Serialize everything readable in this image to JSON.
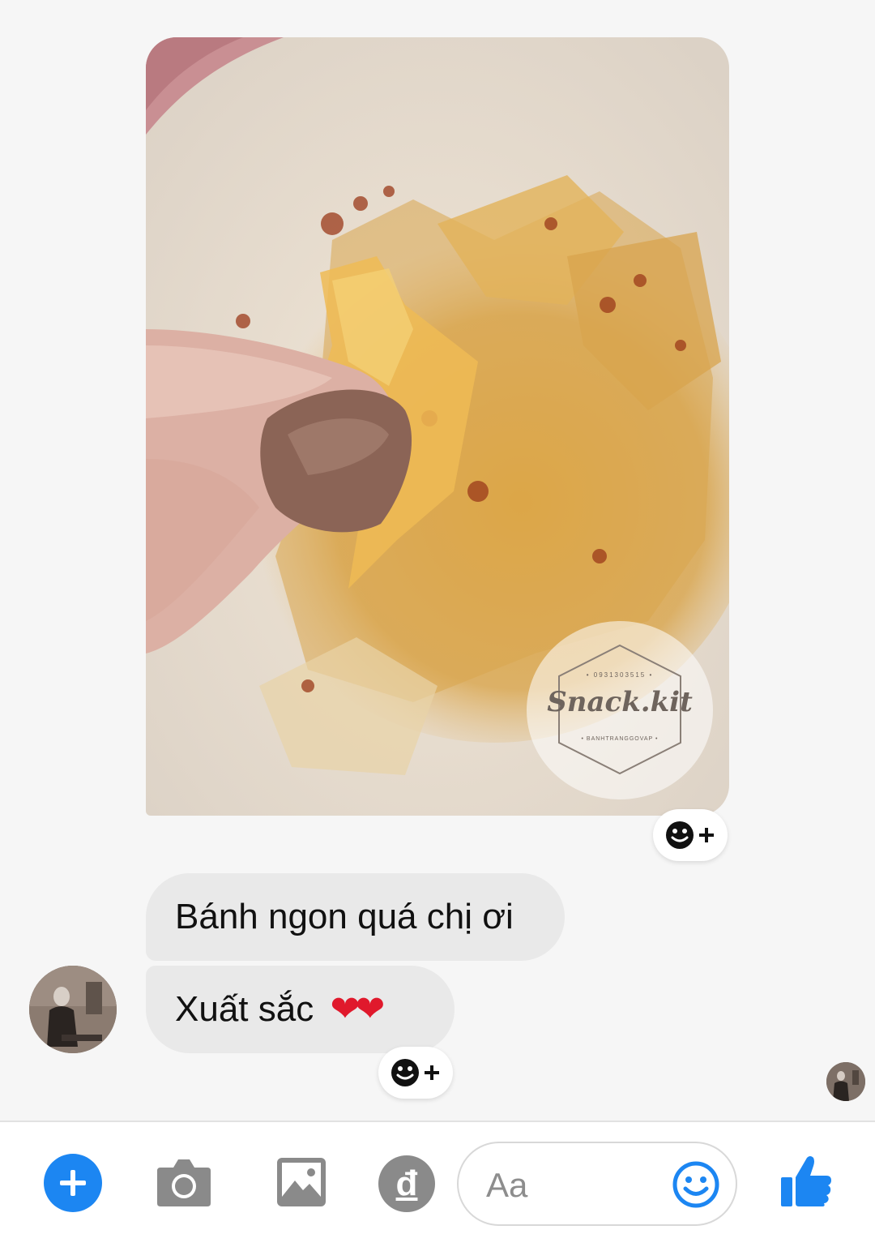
{
  "messages": [
    {
      "type": "photo",
      "watermark": {
        "phone": "• 0931303515 •",
        "brand": "Snack.kit",
        "tagline": "• BANHTRANGGOVAP •"
      }
    },
    {
      "type": "text",
      "text": "Bánh ngon quá chị ơi"
    },
    {
      "type": "text",
      "text": "Xuất sắc",
      "emoji": "❤❤"
    }
  ],
  "composer": {
    "placeholder": "Aa",
    "pay_symbol": "đ",
    "icons": [
      "plus-icon",
      "camera-icon",
      "image-icon",
      "payment-icon",
      "smile-icon",
      "thumbs-up-icon"
    ]
  },
  "colors": {
    "accent": "#1c86f2",
    "bubble": "#e9e9e9",
    "heart": "#e0192c"
  }
}
